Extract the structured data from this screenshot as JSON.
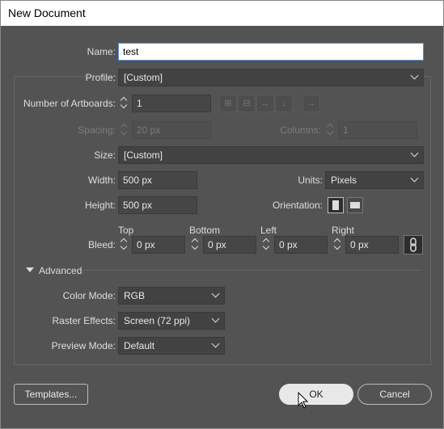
{
  "window": {
    "title": "New Document"
  },
  "name": {
    "label": "Name:",
    "value": "test"
  },
  "profile": {
    "label": "Profile:",
    "value": "[Custom]"
  },
  "artboards": {
    "label": "Number of Artboards:",
    "value": "1"
  },
  "spacing": {
    "label": "Spacing:",
    "value": "20 px"
  },
  "columns": {
    "label": "Columns:",
    "value": "1"
  },
  "size": {
    "label": "Size:",
    "value": "[Custom]"
  },
  "width": {
    "label": "Width:",
    "value": "500 px"
  },
  "units": {
    "label": "Units:",
    "value": "Pixels"
  },
  "height": {
    "label": "Height:",
    "value": "500 px"
  },
  "orientation": {
    "label": "Orientation:",
    "selected": "portrait"
  },
  "bleed": {
    "label": "Bleed:",
    "top": {
      "label": "Top",
      "value": "0 px"
    },
    "bottom": {
      "label": "Bottom",
      "value": "0 px"
    },
    "left": {
      "label": "Left",
      "value": "0 px"
    },
    "right": {
      "label": "Right",
      "value": "0 px"
    }
  },
  "advanced": {
    "label": "Advanced"
  },
  "color_mode": {
    "label": "Color Mode:",
    "value": "RGB"
  },
  "raster_effects": {
    "label": "Raster Effects:",
    "value": "Screen (72 ppi)"
  },
  "preview_mode": {
    "label": "Preview Mode:",
    "value": "Default"
  },
  "buttons": {
    "templates": "Templates...",
    "ok": "OK",
    "cancel": "Cancel"
  }
}
